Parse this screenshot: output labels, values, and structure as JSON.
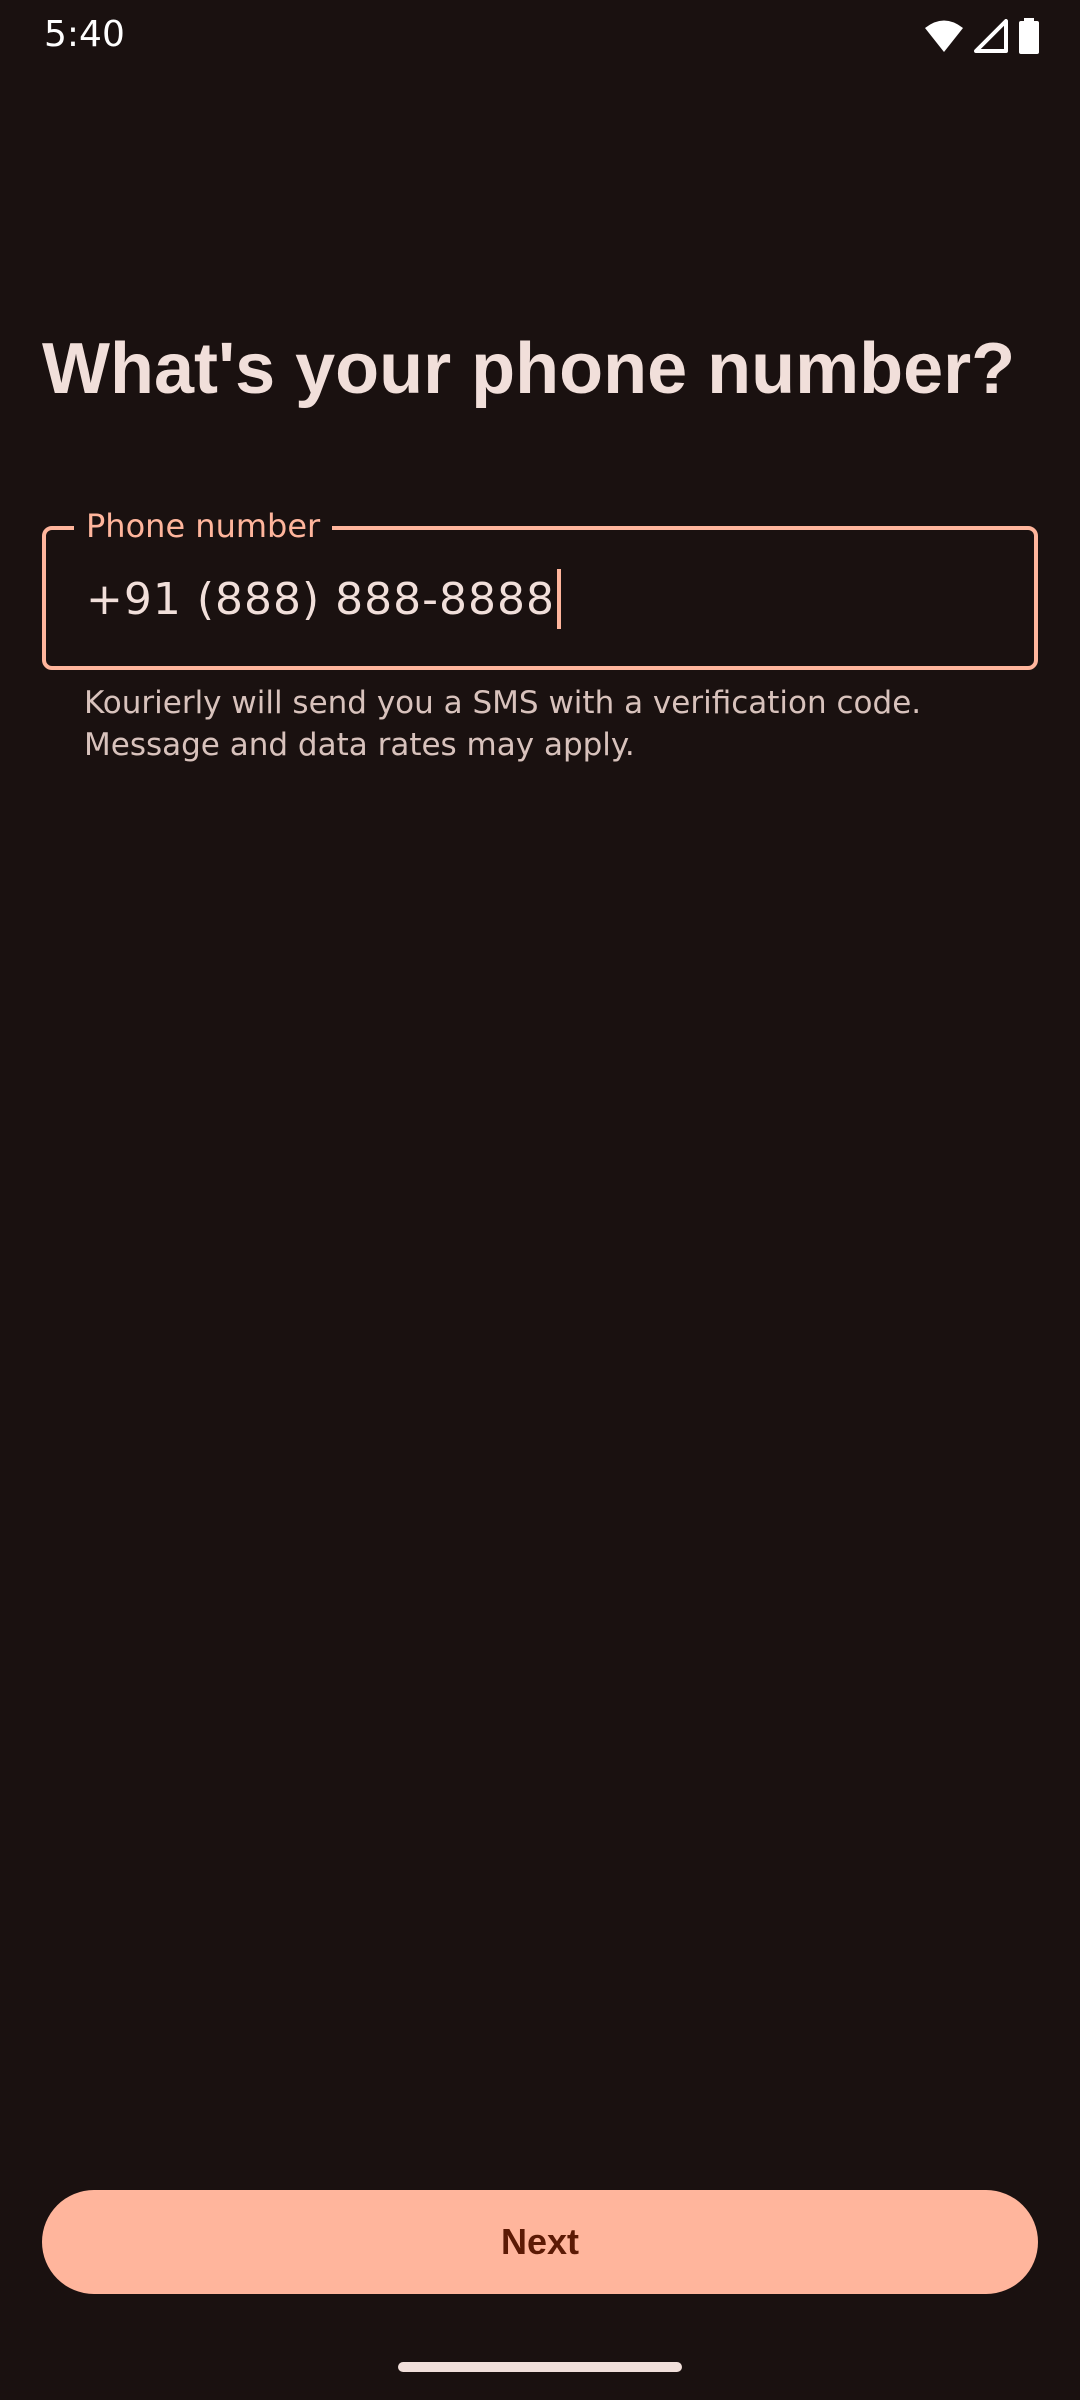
{
  "status_bar": {
    "time": "5:40",
    "icons": [
      "wifi-icon",
      "cellular-signal-icon",
      "battery-icon"
    ]
  },
  "page": {
    "title": "What's your phone number?"
  },
  "phone_field": {
    "label": "Phone number",
    "value": "+91 (888) 888-8888",
    "helper_lines": [
      "Kourierly will send you a SMS with a verification code.",
      "Message and data rates may apply."
    ]
  },
  "actions": {
    "next_label": "Next"
  },
  "colors": {
    "background": "#1a1110",
    "accent": "#ffb59c",
    "on_accent": "#5c1a05",
    "on_surface": "#f1dfda",
    "helper_text": "#d8c2bc"
  }
}
